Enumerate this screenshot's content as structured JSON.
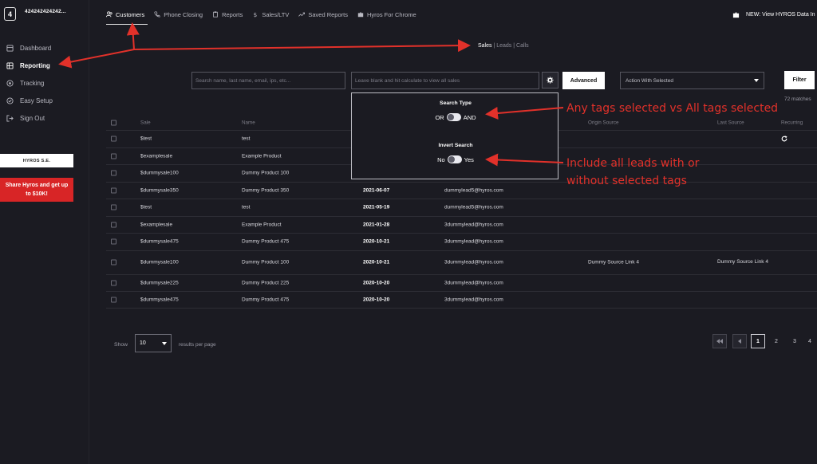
{
  "sidebar": {
    "logo": "4",
    "account_name": "424242424242...",
    "items": [
      {
        "label": "Dashboard",
        "icon": "dashboard-icon"
      },
      {
        "label": "Reporting",
        "icon": "reporting-icon"
      },
      {
        "label": "Tracking",
        "icon": "tracking-icon"
      },
      {
        "label": "Easy Setup",
        "icon": "setup-icon"
      },
      {
        "label": "Sign Out",
        "icon": "sign-out-icon"
      }
    ],
    "badge_label": "HYROS S.E.",
    "promo_label": "Share Hyros and get up to $10K!"
  },
  "topnav": {
    "tabs": [
      "Customers",
      "Phone Closing",
      "Reports",
      "Sales/LTV",
      "Saved Reports",
      "Hyros For Chrome"
    ],
    "banner": "NEW: View HYROS Data In"
  },
  "subnav": {
    "sales": "Sales",
    "sep1": " | ",
    "leads": "Leads",
    "sep2": " | ",
    "calls": "Calls"
  },
  "search": {
    "search_placeholder": "Search name, last name, email, ips, etc...",
    "calc_placeholder": "Leave blank and hit calculate to view all sales",
    "advanced_label": "Advanced",
    "action_label": "Action With Selected",
    "filter_label": "Filter",
    "matches": "72 matches"
  },
  "popup": {
    "search_type_title": "Search Type",
    "or_label": "OR",
    "and_label": "AND",
    "invert_title": "Invert Search",
    "no_label": "No",
    "yes_label": "Yes"
  },
  "table": {
    "headers": {
      "sale": "Sale",
      "name": "Name",
      "origin": "Origin Source",
      "last": "Last Source",
      "recurring": "Recurring"
    },
    "rows": [
      {
        "sale": "$test",
        "name": "test",
        "date": "",
        "email": "",
        "origin": "",
        "last": "",
        "recurring": true
      },
      {
        "sale": "$examplesale",
        "name": "Example Product",
        "date": "",
        "email": "",
        "origin": "",
        "last": ""
      },
      {
        "sale": "$dummysale100",
        "name": "Dummy Product 100",
        "date": "",
        "email": "",
        "origin": "",
        "last": ""
      },
      {
        "sale": "$dummysale350",
        "name": "Dummy Product 350",
        "date": "2021-06-07",
        "email": "dummylead5@hyros.com",
        "origin": "",
        "last": ""
      },
      {
        "sale": "$test",
        "name": "test",
        "date": "2021-05-19",
        "email": "dummylead5@hyros.com",
        "origin": "",
        "last": ""
      },
      {
        "sale": "$examplesale",
        "name": "Example Product",
        "date": "2021-01-28",
        "email": "3dummylead@hyros.com",
        "origin": "",
        "last": ""
      },
      {
        "sale": "$dummysale475",
        "name": "Dummy Product 475",
        "date": "2020-10-21",
        "email": "3dummylead@hyros.com",
        "origin": "",
        "last": ""
      },
      {
        "sale": "$dummysale100",
        "name": "Dummy Product 100",
        "date": "2020-10-21",
        "email": "3dummylead@hyros.com",
        "origin": "Dummy Source Link 4",
        "last": "Dummy Source Link 4"
      },
      {
        "sale": "$dummysale225",
        "name": "Dummy Product 225",
        "date": "2020-10-20",
        "email": "3dummylead@hyros.com",
        "origin": "",
        "last": ""
      },
      {
        "sale": "$dummysale475",
        "name": "Dummy Product 475",
        "date": "2020-10-20",
        "email": "3dummylead@hyros.com",
        "origin": "",
        "last": ""
      }
    ]
  },
  "pagination": {
    "show_label": "Show",
    "per_page": "10",
    "results_label": "results per page",
    "pages": [
      "1",
      "2",
      "3",
      "4"
    ]
  },
  "annotations": {
    "tags_note": "Any tags selected vs All tags selected",
    "invert_note_line1": "Include all leads with or",
    "invert_note_line2": "without selected tags"
  },
  "colors": {
    "annotation": "#e2312a",
    "promo": "#d82526",
    "background": "#1b1b22"
  }
}
